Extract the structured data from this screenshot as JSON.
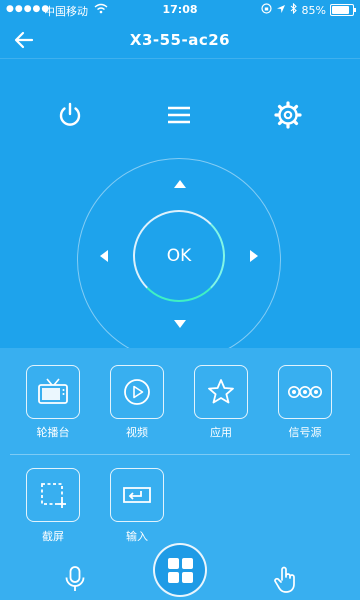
{
  "status_bar": {
    "signal_dots": "●●●●●",
    "carrier": "中国移动",
    "time": "17:08",
    "battery_percent": "85%",
    "battery_level": 0.85
  },
  "header": {
    "title": "X3-55-ac26"
  },
  "remote": {
    "ok_label": "OK"
  },
  "shortcuts": [
    {
      "label": "轮播台",
      "icon": "tv-icon"
    },
    {
      "label": "视频",
      "icon": "play-icon"
    },
    {
      "label": "应用",
      "icon": "star-icon"
    },
    {
      "label": "信号源",
      "icon": "source-icon"
    }
  ],
  "tools": [
    {
      "label": "截屏",
      "icon": "screenshot-icon"
    },
    {
      "label": "输入",
      "icon": "input-icon"
    }
  ],
  "colors": {
    "background": "#1ea3ec",
    "panel": "#38aff0",
    "ok_ring_accent": "#3ff0c4"
  }
}
